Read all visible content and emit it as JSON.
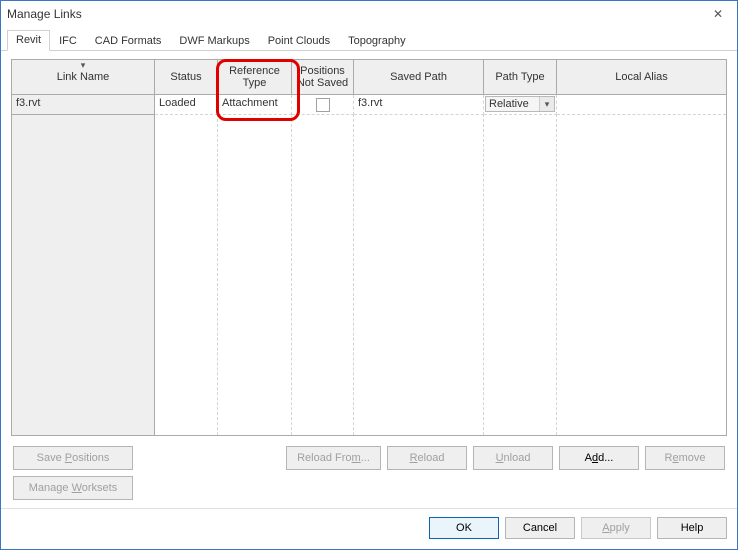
{
  "window": {
    "title": "Manage Links",
    "close_label": "✕"
  },
  "tabs": [
    {
      "label": "Revit",
      "active": true
    },
    {
      "label": "IFC",
      "active": false
    },
    {
      "label": "CAD Formats",
      "active": false
    },
    {
      "label": "DWF Markups",
      "active": false
    },
    {
      "label": "Point Clouds",
      "active": false
    },
    {
      "label": "Topography",
      "active": false
    }
  ],
  "columns": {
    "linkname": "Link Name",
    "status": "Status",
    "reftype": "Reference Type",
    "positions": "Positions Not Saved",
    "saved": "Saved Path",
    "pathtype": "Path Type",
    "alias": "Local Alias"
  },
  "rows": [
    {
      "linkname": "f3.rvt",
      "status": "Loaded",
      "reftype": "Attachment",
      "positions_checked": false,
      "saved": "f3.rvt",
      "pathtype": "Relative",
      "alias": ""
    }
  ],
  "action_buttons": {
    "save_positions": "Save Positions",
    "manage_worksets": "Manage Worksets",
    "reload_from": "Reload From...",
    "reload": "Reload",
    "unload": "Unload",
    "add": "Add...",
    "remove": "Remove"
  },
  "footer_buttons": {
    "ok": "OK",
    "cancel": "Cancel",
    "apply": "Apply",
    "help": "Help"
  }
}
